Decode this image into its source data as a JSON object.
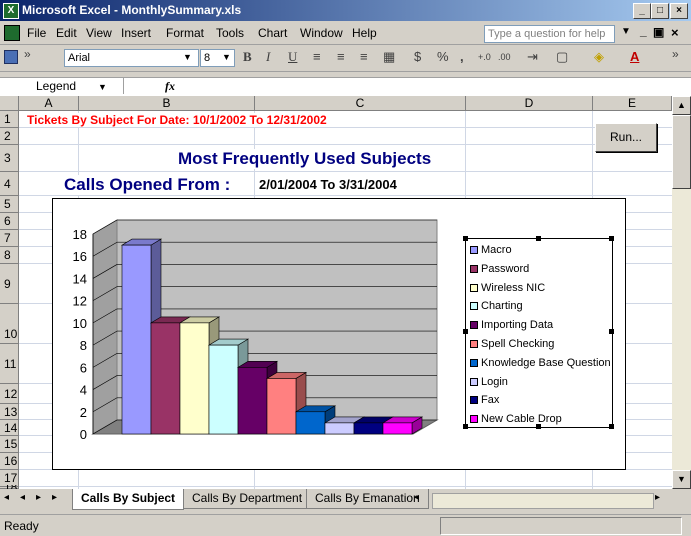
{
  "window": {
    "title": "Microsoft Excel - MonthlySummary.xls"
  },
  "menu": [
    "File",
    "Edit",
    "View",
    "Insert",
    "Format",
    "Tools",
    "Chart",
    "Window",
    "Help"
  ],
  "help_placeholder": "Type a question for help",
  "toolbar": {
    "font": "Arial",
    "size": "8",
    "bold": "B",
    "italic": "I",
    "underline": "U",
    "currency": "$",
    "percent": "%",
    "comma": ","
  },
  "formula_bar": {
    "name_box": "Legend",
    "fx": "fx"
  },
  "columns": [
    "A",
    "B",
    "C",
    "D",
    "E"
  ],
  "rows": [
    "1",
    "2",
    "3",
    "4",
    "5",
    "6",
    "7",
    "8",
    "9",
    "10",
    "11",
    "12",
    "13",
    "14",
    "15",
    "16",
    "17",
    "18"
  ],
  "cells": {
    "b1": "Tickets By Subject For Date: 10/1/2002 To 12/31/2002",
    "c3": "Most Frequently Used Subjects",
    "b4": "Calls Opened From :",
    "c4": "2/01/2004 To 3/31/2004"
  },
  "run_button": "Run...",
  "chart_data": {
    "type": "bar",
    "categories": [
      "Macro",
      "Password",
      "Wireless NIC",
      "Charting",
      "Importing Data",
      "Spell Checking",
      "Knowledge Base Question",
      "Login",
      "Fax",
      "New Cable Drop"
    ],
    "values": [
      17,
      10,
      10,
      8,
      6,
      5,
      2,
      1,
      1,
      1
    ],
    "ylim": [
      0,
      18
    ],
    "yticks": [
      "0",
      "2",
      "4",
      "6",
      "8",
      "10",
      "12",
      "14",
      "16",
      "18"
    ],
    "colors": [
      "#9999ff",
      "#993366",
      "#ffffcc",
      "#ccffff",
      "#660066",
      "#ff8080",
      "#0066cc",
      "#ccccff",
      "#000080",
      "#ff00ff"
    ],
    "grid": true,
    "legend": "right"
  },
  "sheet_tabs": [
    "Calls By Subject",
    "Calls By Department",
    "Calls By Emanation"
  ],
  "status": "Ready"
}
